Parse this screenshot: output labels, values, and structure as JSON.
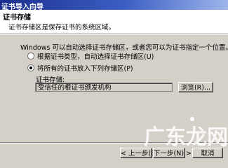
{
  "window": {
    "title": "证书导入向导"
  },
  "header": {
    "title": "证书存储",
    "description": "证书存储区是保存证书的系统区域。"
  },
  "body": {
    "intro": "Windows 可以自动选择证书存储区，或者您可以为证书指定一个位置。",
    "options": [
      {
        "label": "根据证书类型，自动选择证书存储区(U)",
        "checked": false
      },
      {
        "label": "将所有的证书放入下列存储区(P)",
        "checked": true
      }
    ],
    "store_label": "证书存储:",
    "store_value": "受信任的根证书颁发机构",
    "browse_label": "浏览(R)..."
  },
  "footer": {
    "back_label": "< 上一步(B)",
    "next_label": "下一步(N) >",
    "cancel_label": "取消"
  },
  "watermark": {
    "text": "广东龙网"
  }
}
